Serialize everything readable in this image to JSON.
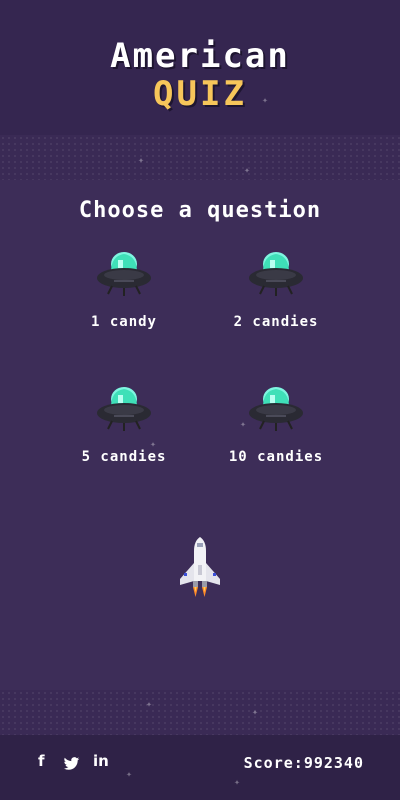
{
  "title": {
    "line1": "American",
    "line2": "QUIZ"
  },
  "prompt": "Choose a question",
  "options": [
    {
      "label": "1 candy",
      "icon": "ufo-icon"
    },
    {
      "label": "2 candies",
      "icon": "ufo-icon"
    },
    {
      "label": "5 candies",
      "icon": "ufo-icon"
    },
    {
      "label": "10 candies",
      "icon": "ufo-icon"
    }
  ],
  "player": {
    "icon": "space-shuttle-icon"
  },
  "footer": {
    "social": [
      {
        "label": "f",
        "icon": "facebook-icon"
      },
      {
        "label": "twitter",
        "icon": "twitter-icon"
      },
      {
        "label": "in",
        "icon": "linkedin-icon"
      }
    ],
    "score_label": "Score:",
    "score_value": "992340"
  },
  "colors": {
    "background": "#3d2d58",
    "header": "#352650",
    "accent": "#f7c65a",
    "text": "#ffffff",
    "ufo_dome": "#3fe0b8"
  }
}
